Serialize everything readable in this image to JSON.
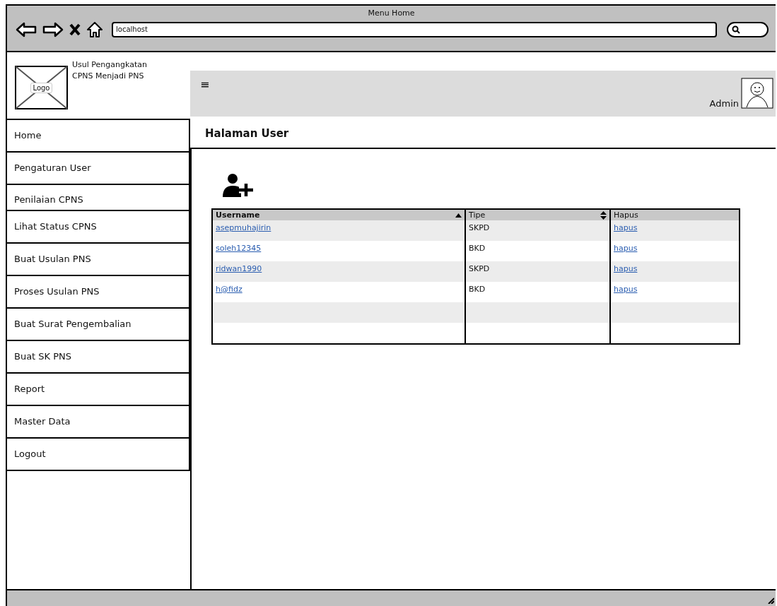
{
  "window": {
    "title": "Menu Home"
  },
  "browser": {
    "address": "localhost"
  },
  "brand": {
    "logo": "Logo",
    "title_lines": [
      "Usul Pengangkatan",
      "CPNS Menjadi PNS"
    ]
  },
  "header": {
    "menu_icon": "≡",
    "user": "Admin"
  },
  "sidebar": {
    "items": [
      {
        "label": "Home"
      },
      {
        "label": "Pengaturan User"
      },
      {
        "label": "Penilaian CPNS",
        "kind": "short"
      },
      {
        "label": "Lihat Status CPNS"
      },
      {
        "label": "Buat Usulan PNS"
      },
      {
        "label": "Proses Usulan PNS"
      },
      {
        "label": "Buat Surat Pengembalian"
      },
      {
        "label": "Buat SK PNS"
      },
      {
        "label": "Report"
      },
      {
        "label": "Master Data"
      },
      {
        "label": "Logout"
      }
    ]
  },
  "page": {
    "title": "Halaman User"
  },
  "table": {
    "columns": [
      {
        "label": "Username",
        "sortable": true,
        "sorted": true
      },
      {
        "label": "Tipe",
        "sortable": true,
        "sorted": false
      },
      {
        "label": "Hapus",
        "sortable": false,
        "sorted": false
      }
    ],
    "rows": [
      {
        "username": "asepmuhajirin",
        "tipe": "SKPD",
        "hapus": "hapus"
      },
      {
        "username": "soleh12345",
        "tipe": "BKD",
        "hapus": "hapus"
      },
      {
        "username": "ridwan1990",
        "tipe": "SKPD",
        "hapus": "hapus"
      },
      {
        "username": "h@fidz",
        "tipe": "BKD",
        "hapus": "hapus"
      }
    ]
  }
}
